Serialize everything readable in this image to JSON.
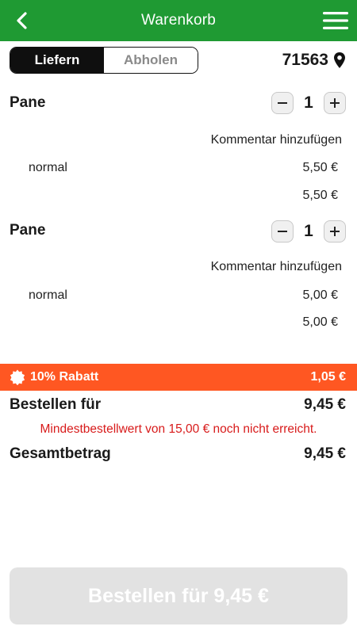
{
  "header": {
    "title": "Warenkorb",
    "back_icon": "chevron-left-icon",
    "menu_icon": "hamburger-menu-icon"
  },
  "mode_toggle": {
    "options": [
      "Liefern",
      "Abholen"
    ],
    "selected": "Liefern"
  },
  "location": {
    "zip": "71563",
    "icon": "location-pin-icon"
  },
  "cart": {
    "items": [
      {
        "name": "Pane",
        "quantity": "1",
        "comment_label": "Kommentar hinzufügen",
        "variant": "normal",
        "variant_price": "5,50 €",
        "total": "5,50 €"
      },
      {
        "name": "Pane",
        "quantity": "1",
        "comment_label": "Kommentar hinzufügen",
        "variant": "normal",
        "variant_price": "5,00 €",
        "total": "5,00 €"
      }
    ]
  },
  "discount": {
    "label": "10% Rabatt",
    "amount": "1,05 €",
    "color": "#ff5722"
  },
  "summary": {
    "order_label": "Bestellen für",
    "order_amount": "9,45 €",
    "warning": "Mindestbestellwert von 15,00 € noch nicht erreicht.",
    "total_label": "Gesamtbetrag",
    "total_amount": "9,45 €"
  },
  "checkout_button": {
    "label": "Bestellen für 9,45 €"
  },
  "colors": {
    "brand": "#1f9a33",
    "warning": "#d81b1b",
    "disabled_button": "#e2e2e2"
  }
}
